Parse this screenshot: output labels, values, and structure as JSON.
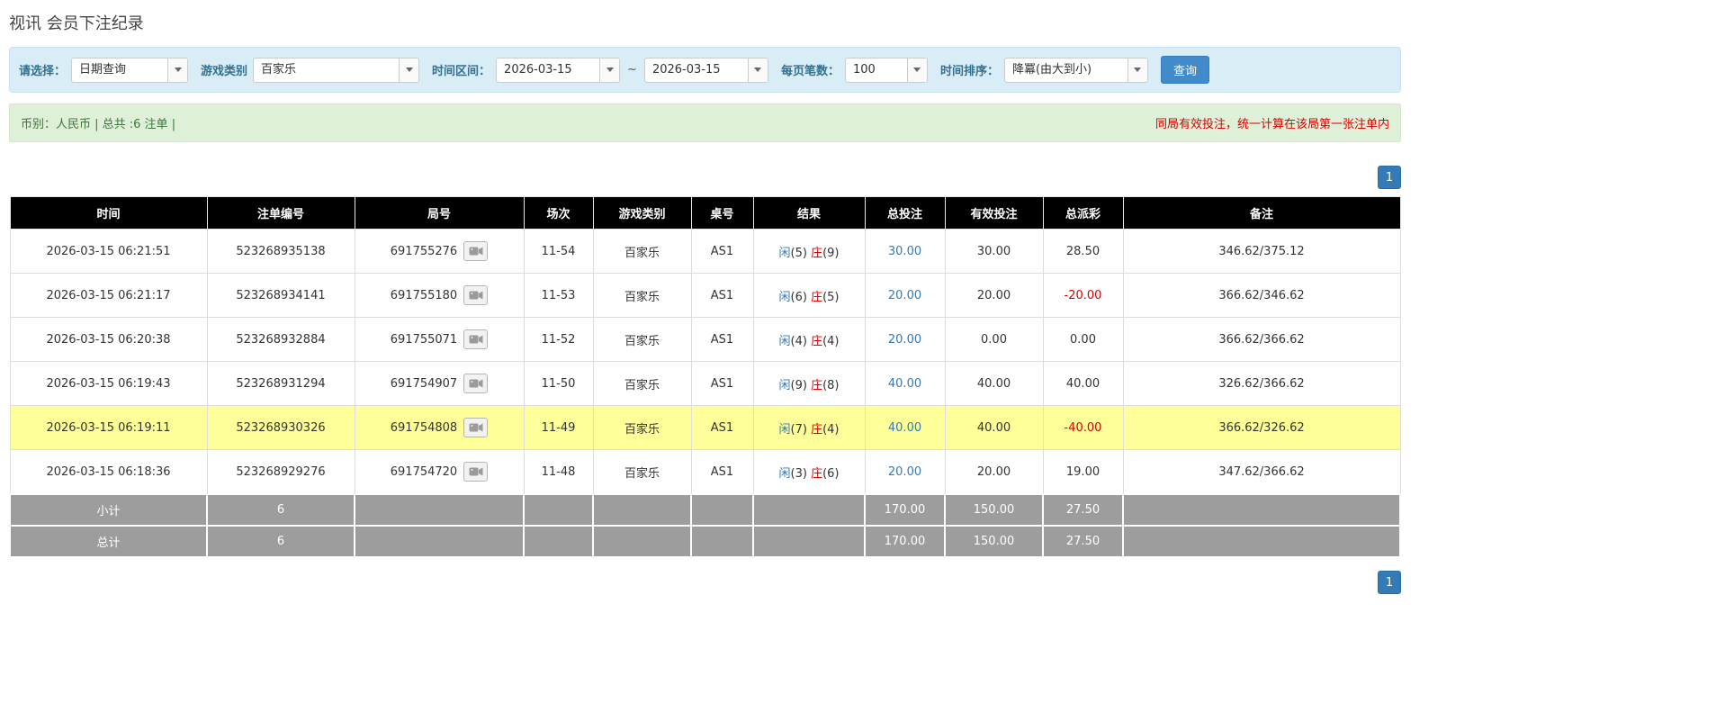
{
  "page": {
    "title": "视讯 会员下注纪录"
  },
  "colors": {
    "accent-blue": "#337ab7",
    "button-blue": "#428bca",
    "red": "#dd0000",
    "header-bg": "#000000",
    "highlight-yellow": "#ffff99",
    "footer-gray": "#9d9d9d",
    "filter-bg": "#d9edf7",
    "filter-label": "#31708f",
    "summary-bg": "#dff0d8",
    "summary-text": "#3c763d"
  },
  "filters": {
    "select_label": "请选择：",
    "select_value": "日期查询",
    "game_label": "游戏类别",
    "game_value": "百家乐",
    "range_label": "时间区间：",
    "date_from": "2026-03-15",
    "tilde": "~",
    "date_to": "2026-03-15",
    "per_page_label": "每页笔数：",
    "per_page_value": "100",
    "sort_label": "时间排序：",
    "sort_value": "降冪(由大到小)",
    "search_button": "查询"
  },
  "summary": {
    "left": "币别：人民币 | 总共 :6 注单 |",
    "right": "同局有效投注，统一计算在该局第一张注单内"
  },
  "pagination": {
    "page": "1"
  },
  "table": {
    "headers": [
      "时间",
      "注单编号",
      "局号",
      "场次",
      "游戏类别",
      "桌号",
      "结果",
      "总投注",
      "有效投注",
      "总派彩",
      "备注"
    ],
    "rows": [
      {
        "time": "2026-03-15 06:21:51",
        "bet_id": "523268935138",
        "round": "691755276",
        "session": "11-54",
        "game": "百家乐",
        "table_no": "AS1",
        "player": "闲",
        "player_n": "(5)",
        "banker": "庄",
        "banker_n": "(9)",
        "total_bet": "30.00",
        "valid_bet": "30.00",
        "payout": "28.50",
        "note": "346.62/375.12",
        "highlight": false
      },
      {
        "time": "2026-03-15 06:21:17",
        "bet_id": "523268934141",
        "round": "691755180",
        "session": "11-53",
        "game": "百家乐",
        "table_no": "AS1",
        "player": "闲",
        "player_n": "(6)",
        "banker": "庄",
        "banker_n": "(5)",
        "total_bet": "20.00",
        "valid_bet": "20.00",
        "payout": "-20.00",
        "note": "366.62/346.62",
        "highlight": false
      },
      {
        "time": "2026-03-15 06:20:38",
        "bet_id": "523268932884",
        "round": "691755071",
        "session": "11-52",
        "game": "百家乐",
        "table_no": "AS1",
        "player": "闲",
        "player_n": "(4)",
        "banker": "庄",
        "banker_n": "(4)",
        "total_bet": "20.00",
        "valid_bet": "0.00",
        "payout": "0.00",
        "note": "366.62/366.62",
        "highlight": false
      },
      {
        "time": "2026-03-15 06:19:43",
        "bet_id": "523268931294",
        "round": "691754907",
        "session": "11-50",
        "game": "百家乐",
        "table_no": "AS1",
        "player": "闲",
        "player_n": "(9)",
        "banker": "庄",
        "banker_n": "(8)",
        "total_bet": "40.00",
        "valid_bet": "40.00",
        "payout": "40.00",
        "note": "326.62/366.62",
        "highlight": false
      },
      {
        "time": "2026-03-15 06:19:11",
        "bet_id": "523268930326",
        "round": "691754808",
        "session": "11-49",
        "game": "百家乐",
        "table_no": "AS1",
        "player": "闲",
        "player_n": "(7)",
        "banker": "庄",
        "banker_n": "(4)",
        "total_bet": "40.00",
        "valid_bet": "40.00",
        "payout": "-40.00",
        "note": "366.62/326.62",
        "highlight": true
      },
      {
        "time": "2026-03-15 06:18:36",
        "bet_id": "523268929276",
        "round": "691754720",
        "session": "11-48",
        "game": "百家乐",
        "table_no": "AS1",
        "player": "闲",
        "player_n": "(3)",
        "banker": "庄",
        "banker_n": "(6)",
        "total_bet": "20.00",
        "valid_bet": "20.00",
        "payout": "19.00",
        "note": "347.62/366.62",
        "highlight": false
      }
    ],
    "subtotal": {
      "label": "小计",
      "count": "6",
      "total_bet": "170.00",
      "valid_bet": "150.00",
      "payout": "27.50"
    },
    "total": {
      "label": "总计",
      "count": "6",
      "total_bet": "170.00",
      "valid_bet": "150.00",
      "payout": "27.50"
    }
  }
}
